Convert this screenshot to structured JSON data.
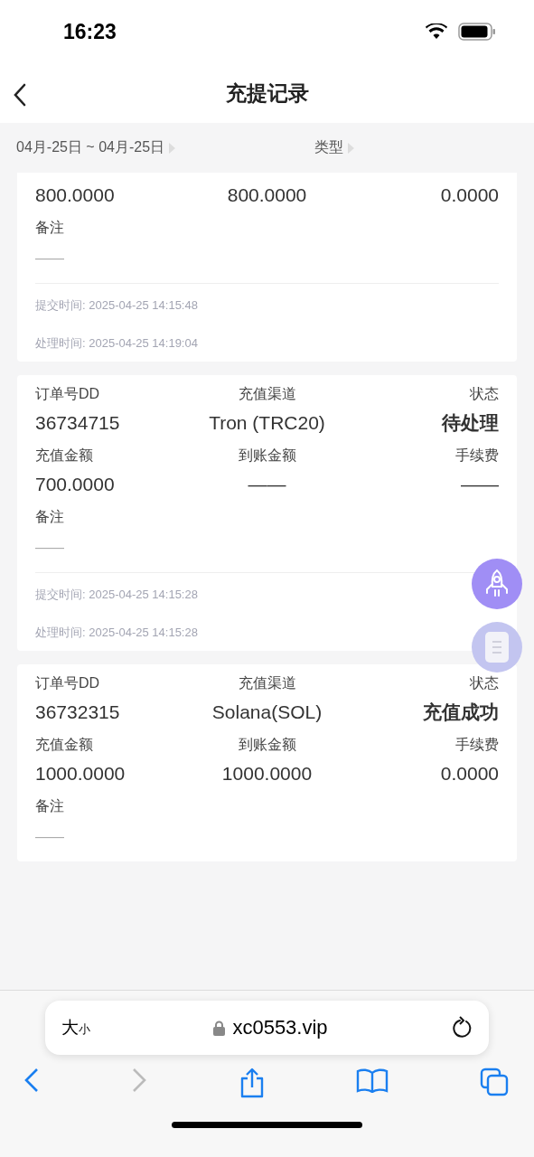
{
  "status_bar": {
    "time": "16:23"
  },
  "nav": {
    "title": "充提记录"
  },
  "filters": [
    {
      "label": "04月-25日 ~ 04月-25日"
    },
    {
      "label": "类型"
    }
  ],
  "records": [
    {
      "amounts": {
        "values": [
          "800.0000",
          "800.0000",
          "0.0000"
        ]
      },
      "remark_label": "备注",
      "remark": "——",
      "submit_time": "提交时间: 2025-04-25 14:15:48",
      "process_time": "处理时间: 2025-04-25 14:19:04"
    },
    {
      "order": {
        "labels": [
          "订单号DD",
          "充值渠道",
          "状态"
        ],
        "values": [
          "36734715",
          "Tron (TRC20)",
          "待处理"
        ]
      },
      "amounts": {
        "labels": [
          "充值金额",
          "到账金额",
          "手续费"
        ],
        "values": [
          "700.0000",
          "——",
          "——"
        ]
      },
      "remark_label": "备注",
      "remark": "——",
      "submit_time": "提交时间: 2025-04-25 14:15:28",
      "process_time": "处理时间: 2025-04-25 14:15:28"
    },
    {
      "order": {
        "labels": [
          "订单号DD",
          "充值渠道",
          "状态"
        ],
        "values": [
          "36732315",
          "Solana(SOL)",
          "充值成功"
        ]
      },
      "amounts": {
        "labels": [
          "充值金额",
          "到账金额",
          "手续费"
        ],
        "values": [
          "1000.0000",
          "1000.0000",
          "0.0000"
        ]
      },
      "remark_label": "备注",
      "remark": "——"
    }
  ],
  "browser": {
    "text_size": {
      "big": "大",
      "small": "小"
    },
    "url": "xc0553.vip"
  }
}
